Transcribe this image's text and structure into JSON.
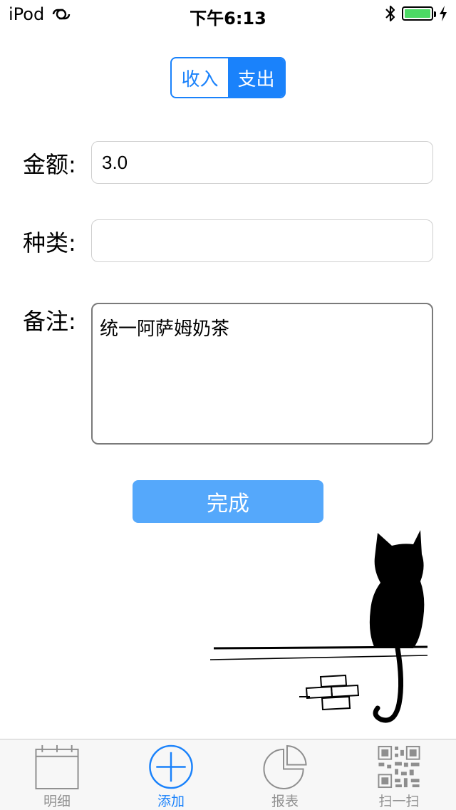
{
  "status_bar": {
    "device": "iPod",
    "time": "下午6:13"
  },
  "segmented_control": {
    "income_label": "收入",
    "expense_label": "支出",
    "selected": "支出"
  },
  "form": {
    "amount_label": "金额:",
    "amount_value": "3.0",
    "category_label": "种类:",
    "category_value": "",
    "note_label": "备注:",
    "note_value": "统一阿萨姆奶茶",
    "done_label": "完成"
  },
  "tab_bar": {
    "tabs": [
      {
        "label": "明细",
        "icon": "calendar-icon",
        "active": false
      },
      {
        "label": "添加",
        "icon": "add-circle-icon",
        "active": true
      },
      {
        "label": "报表",
        "icon": "pie-chart-icon",
        "active": false
      },
      {
        "label": "扫一扫",
        "icon": "qr-code-icon",
        "active": false
      }
    ]
  },
  "colors": {
    "accent": "#1a82fb",
    "done_button": "#55a8fb",
    "battery": "#4cd964",
    "tab_inactive": "#929292"
  }
}
